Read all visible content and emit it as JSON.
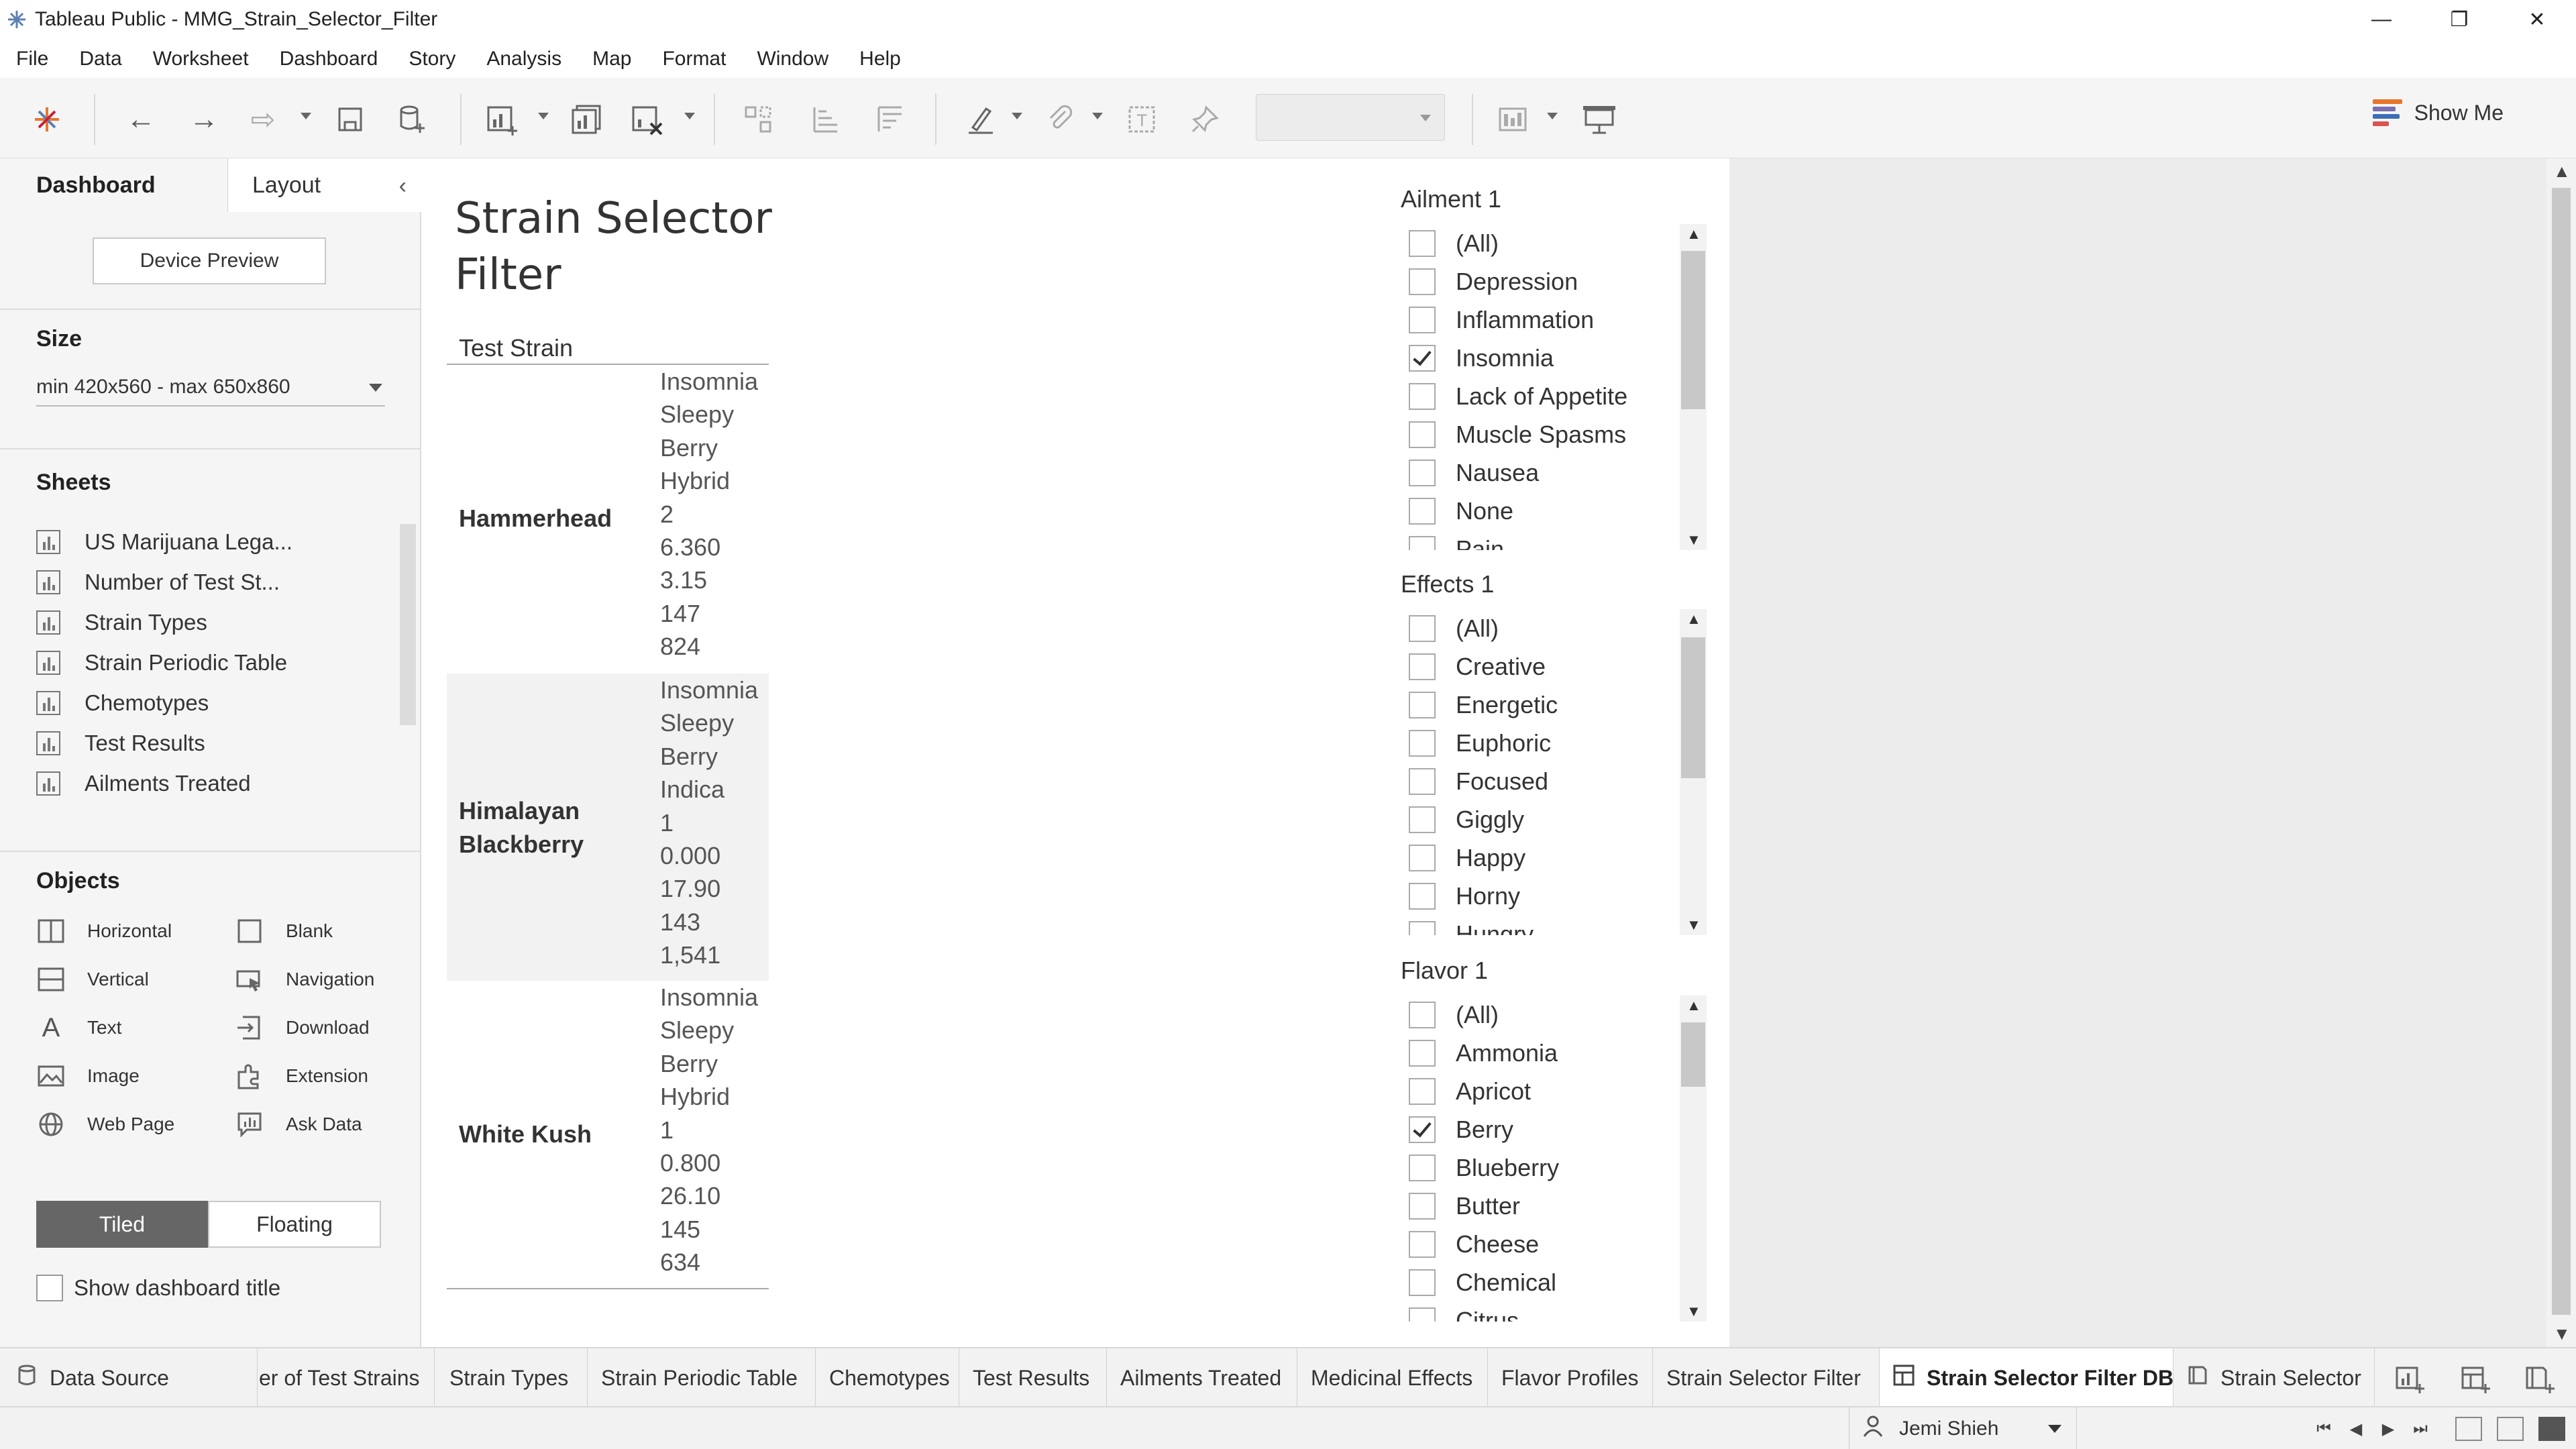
{
  "window": {
    "title": "Tableau Public - MMG_Strain_Selector_Filter",
    "controls": [
      "—",
      "❐",
      "✕"
    ]
  },
  "menu": [
    "File",
    "Data",
    "Worksheet",
    "Dashboard",
    "Story",
    "Analysis",
    "Map",
    "Format",
    "Window",
    "Help"
  ],
  "toolbar": {
    "show_me_label": "Show Me",
    "icons": [
      "tableau-logo",
      "undo",
      "redo",
      "replay",
      "save",
      "new-data-source",
      "new-worksheet",
      "duplicate",
      "clear",
      "group",
      "sort-ascending",
      "sort-descending",
      "highlight",
      "attach",
      "text-label",
      "pin",
      "fit-dropdown",
      "show-cards",
      "presentation"
    ]
  },
  "left_pane": {
    "tabs": {
      "dashboard": "Dashboard",
      "layout": "Layout"
    },
    "device_preview": "Device Preview",
    "size_title": "Size",
    "size_value": "min 420x560 - max 650x860",
    "sheets_title": "Sheets",
    "sheets": [
      "US Marijuana Lega...",
      "Number of Test St...",
      "Strain Types",
      "Strain Periodic Table",
      "Chemotypes",
      "Test Results",
      "Ailments Treated"
    ],
    "objects_title": "Objects",
    "objects": {
      "horizontal": "Horizontal",
      "blank": "Blank",
      "vertical": "Vertical",
      "navigation": "Navigation",
      "text": "Text",
      "download": "Download",
      "image": "Image",
      "extension": "Extension",
      "web_page": "Web Page",
      "ask_data": "Ask Data"
    },
    "tiled": "Tiled",
    "floating": "Floating",
    "show_title": "Show dashboard title"
  },
  "dashboard": {
    "title_line1": "Strain Selector",
    "title_line2": "Filter",
    "column_header": "Test Strain",
    "strains": [
      {
        "name_line1": "Hammerhead",
        "name_line2": "",
        "values": [
          "Insomnia",
          "Sleepy",
          "Berry",
          "Hybrid",
          "2",
          "6.360",
          "3.15",
          "147",
          "824"
        ]
      },
      {
        "name_line1": "Himalayan",
        "name_line2": "Blackberry",
        "values": [
          "Insomnia",
          "Sleepy",
          "Berry",
          "Indica",
          "1",
          "0.000",
          "17.90",
          "143",
          "1,541"
        ]
      },
      {
        "name_line1": "White Kush",
        "name_line2": "",
        "values": [
          "Insomnia",
          "Sleepy",
          "Berry",
          "Hybrid",
          "1",
          "0.800",
          "26.10",
          "145",
          "634"
        ]
      }
    ]
  },
  "filters": {
    "ailment": {
      "title": "Ailment 1",
      "items": [
        {
          "label": "(All)",
          "checked": false
        },
        {
          "label": "Depression",
          "checked": false
        },
        {
          "label": "Inflammation",
          "checked": false
        },
        {
          "label": "Insomnia",
          "checked": true
        },
        {
          "label": "Lack of Appetite",
          "checked": false
        },
        {
          "label": "Muscle Spasms",
          "checked": false
        },
        {
          "label": "Nausea",
          "checked": false
        },
        {
          "label": "None",
          "checked": false
        },
        {
          "label": "Pain",
          "checked": false
        }
      ]
    },
    "effects": {
      "title": "Effects 1",
      "items": [
        {
          "label": "(All)",
          "checked": false
        },
        {
          "label": "Creative",
          "checked": false
        },
        {
          "label": "Energetic",
          "checked": false
        },
        {
          "label": "Euphoric",
          "checked": false
        },
        {
          "label": "Focused",
          "checked": false
        },
        {
          "label": "Giggly",
          "checked": false
        },
        {
          "label": "Happy",
          "checked": false
        },
        {
          "label": "Horny",
          "checked": false
        },
        {
          "label": "Hungry",
          "checked": false
        }
      ]
    },
    "flavor": {
      "title": "Flavor 1",
      "items": [
        {
          "label": "(All)",
          "checked": false
        },
        {
          "label": "Ammonia",
          "checked": false
        },
        {
          "label": "Apricot",
          "checked": false
        },
        {
          "label": "Berry",
          "checked": true
        },
        {
          "label": "Blueberry",
          "checked": false
        },
        {
          "label": "Butter",
          "checked": false
        },
        {
          "label": "Cheese",
          "checked": false
        },
        {
          "label": "Chemical",
          "checked": false
        },
        {
          "label": "Citrus",
          "checked": false
        }
      ]
    }
  },
  "bottom_tabs": {
    "data_source": "Data Source",
    "sheets": [
      "er of Test Strains",
      "Strain Types",
      "Strain Periodic Table",
      "Chemotypes",
      "Test Results",
      "Ailments Treated",
      "Medicinal Effects",
      "Flavor Profiles",
      "Strain Selector Filter"
    ],
    "active": "Strain Selector Filter DB",
    "story": "Strain Selector"
  },
  "status": {
    "user": "Jemi Shieh"
  },
  "colors": {
    "accent_dark": "#666666",
    "showme_bars": [
      "#e8762c",
      "#7b6fb0",
      "#3c6fb5",
      "#d9534f"
    ]
  }
}
